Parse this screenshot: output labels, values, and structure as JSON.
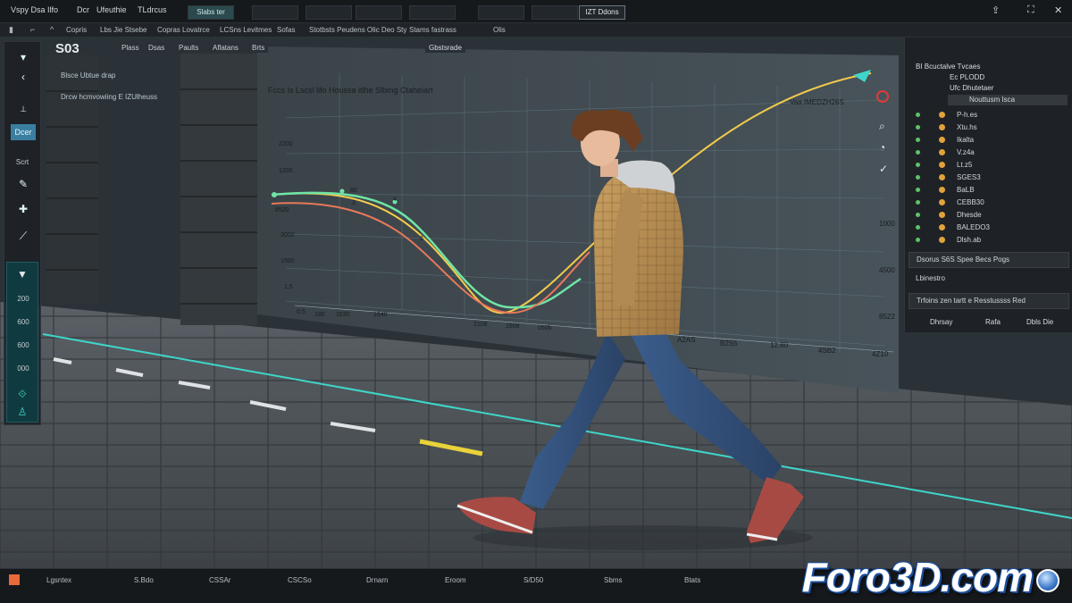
{
  "menubar": {
    "items": [
      "Vspy Dsa Ilfo",
      "Dcr",
      "Ufeuthie",
      "TLdrcus"
    ],
    "tabs": [
      "Slabs ter",
      "",
      "",
      "",
      "",
      "",
      "",
      "IZT Ddons"
    ],
    "icons": [
      "share-icon",
      "fullscreen-icon",
      "close-icon"
    ]
  },
  "toolbar": {
    "brand": "S03",
    "labels": [
      "Copris",
      "Lbs Jie Stsebe",
      "Copras Lovatrce",
      "LCSns Levitmes",
      "Sofas",
      "Stotbsts Peudens Olic Deo Sty",
      "Stams fastrass",
      "Olis"
    ],
    "tool_labels": [
      "Plass",
      "Dsas",
      "Paults",
      "Aflatans",
      "Brts",
      "Gbstsrade"
    ]
  },
  "left_toolbar": {
    "door_label": "Dcer",
    "sub_label": "Scrt",
    "values": [
      "200",
      "600",
      "600",
      "000"
    ],
    "icons": [
      "arrow-icon",
      "chevron-icon",
      "move-icon",
      "plus-icon",
      "pen-icon",
      "keyframe-icon",
      "curve-icon",
      "person-icon"
    ]
  },
  "overlay": {
    "header_line1": "Blsce   Ubtue drap",
    "header_line2": "Drcw hcmvowiing  E IZUlheuss",
    "chart_title": "Fccs Is Lscsl lifo Houssa itlhe Slbmg Ctaheiart",
    "legend_text": "Vaa IMEDZH26S",
    "y_labels": [
      "1400",
      "2200",
      "1200",
      "8520",
      "2000",
      "1500",
      "1.5"
    ],
    "x_labels": [
      "0.5",
      "180",
      "1630",
      "1640",
      "2108",
      "1808",
      "050b",
      "A2AS",
      "B2S5",
      "12.80",
      "4SB2",
      "4Z10"
    ],
    "right_axis": [
      "1000",
      "4500",
      "8522"
    ],
    "marker_labels": [
      "80",
      "3",
      "4",
      "6"
    ]
  },
  "right_panel": {
    "header": "BI Bcuctalve Tvcaes",
    "sub1": "Ec PLODD",
    "sub2": "Ufc Dhutetaer",
    "bar_label": "Nouttusm Isca",
    "rows": [
      "P-h.es",
      "Xtu.hs",
      "Ikalta",
      "V.z4a",
      "Lt.z5",
      "SGES3",
      "BaLB",
      "CEBB30",
      "Dhesde",
      "BALEDO3",
      "Dlsh.ab"
    ],
    "box1": "Dsorus S6S Spee Becs Pogs",
    "box2": "Lbinestro",
    "box3": "Trfoins zen tartt e Resstussss Red",
    "footer": [
      "Dhrsay",
      "Rafa",
      "Dbls Die"
    ]
  },
  "bottom_bar": {
    "items": [
      "Lgsntex",
      "S.Bdo",
      "CSSAr",
      "CSCSo",
      "Drnarn",
      "Eroom",
      "S/D50",
      "Sbms",
      "Btats"
    ]
  },
  "watermark": {
    "text": "Foro3D.com"
  },
  "colors": {
    "green_curve": "#6fe4a6",
    "orange_curve": "#e8785a",
    "yellow_curve": "#f2c94c",
    "accent_teal": "#3fd6c9"
  }
}
